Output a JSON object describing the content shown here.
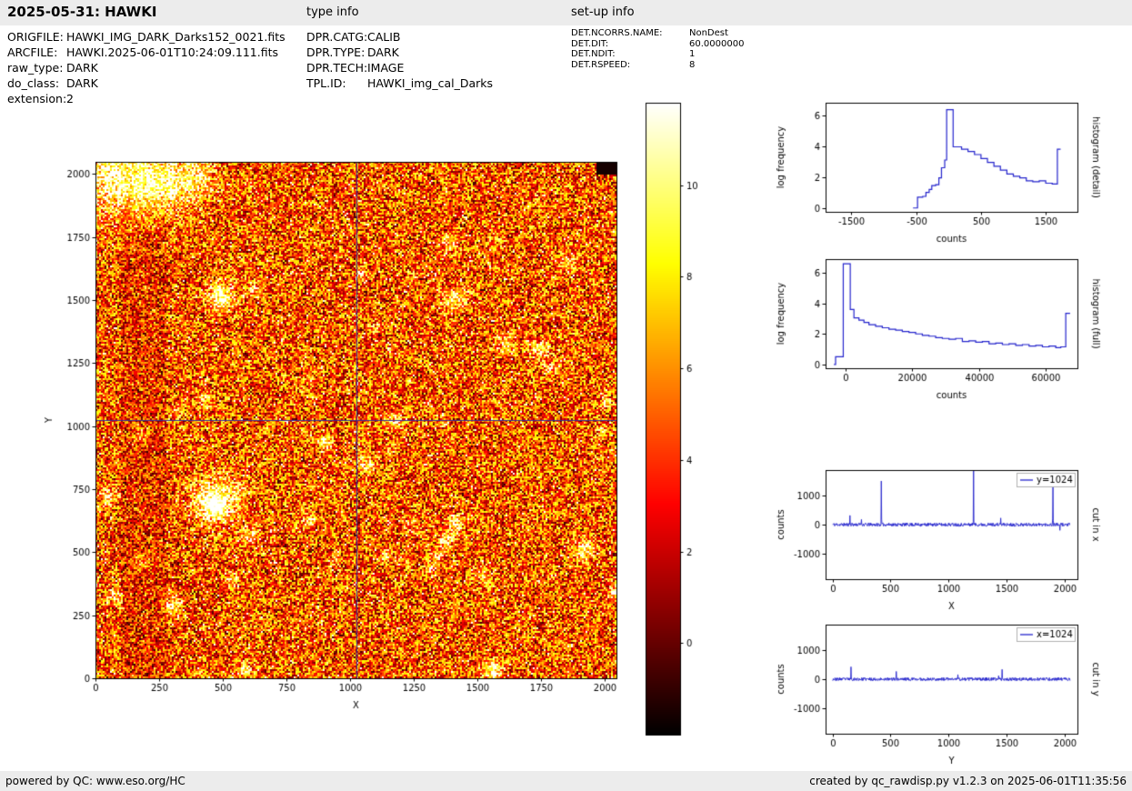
{
  "header": {
    "title": "2025-05-31: HAWKI",
    "type_info_label": "type info",
    "setup_info_label": "set-up info"
  },
  "file_info": {
    "rows": [
      {
        "label": "ORIGFILE:",
        "value": "HAWKI_IMG_DARK_Darks152_0021.fits"
      },
      {
        "label": "ARCFILE:",
        "value": "HAWKI.2025-06-01T10:24:09.111.fits"
      },
      {
        "label": "raw_type:",
        "value": "DARK"
      },
      {
        "label": "do_class:",
        "value": "DARK"
      },
      {
        "label": "extension:",
        "value": "2"
      }
    ]
  },
  "type_info": {
    "rows": [
      {
        "label": "DPR.CATG:",
        "value": "CALIB"
      },
      {
        "label": "DPR.TYPE:",
        "value": "DARK"
      },
      {
        "label": "DPR.TECH:",
        "value": "IMAGE"
      },
      {
        "label": "TPL.ID:",
        "value": "HAWKI_img_cal_Darks"
      }
    ]
  },
  "setup_info": {
    "rows": [
      {
        "label": "DET.NCORRS.NAME:",
        "value": "NonDest"
      },
      {
        "label": "DET.DIT:",
        "value": "60.0000000"
      },
      {
        "label": "DET.NDIT:",
        "value": "1"
      },
      {
        "label": "DET.RSPEED:",
        "value": "8"
      }
    ]
  },
  "footer": {
    "left": "powered by QC: www.eso.org/HC",
    "right": "created by qc_rawdisp.py v1.2.3 on 2025-06-01T11:35:56"
  },
  "colors": {
    "line": "#2424cc",
    "crosshair": "#333399",
    "frame": "#000000",
    "bar_background": "#ececec"
  },
  "chart_data": [
    {
      "id": "raw_image",
      "type": "heatmap",
      "description": "2048x2048 raw dark frame shown with hot colormap, crosshair at x=1024 y=1024",
      "xlabel": "X",
      "ylabel": "Y",
      "xlim": [
        0,
        2048
      ],
      "ylim": [
        0,
        2048
      ],
      "xticks": [
        0,
        250,
        500,
        750,
        1000,
        1250,
        1500,
        1750,
        2000
      ],
      "yticks": [
        0,
        250,
        500,
        750,
        1000,
        1250,
        1500,
        1750,
        2000
      ],
      "crosshair_x": 1024,
      "crosshair_y": 1024,
      "colormap": "hot",
      "colorbar": {
        "ticks": [
          0,
          2,
          4,
          6,
          8,
          10
        ],
        "vmin": -2,
        "vmax": 11.8
      }
    },
    {
      "id": "histogram_detail",
      "type": "line",
      "style": "step",
      "xlabel": "counts",
      "ylabel": "log frequency",
      "right_label": "histogram (detail)",
      "xlim": [
        -1900,
        1990
      ],
      "ylim": [
        -0.25,
        6.8
      ],
      "xticks": [
        -1500,
        -500,
        500,
        1500
      ],
      "yticks": [
        0,
        2,
        4,
        6
      ],
      "points": [
        [
          -550,
          0
        ],
        [
          -480,
          0.7
        ],
        [
          -400,
          0.75
        ],
        [
          -350,
          1.0
        ],
        [
          -300,
          1.2
        ],
        [
          -260,
          1.45
        ],
        [
          -200,
          1.5
        ],
        [
          -150,
          1.95
        ],
        [
          -110,
          2.6
        ],
        [
          -60,
          3.1
        ],
        [
          -30,
          6.35
        ],
        [
          70,
          3.95
        ],
        [
          200,
          3.8
        ],
        [
          300,
          3.65
        ],
        [
          400,
          3.45
        ],
        [
          500,
          3.2
        ],
        [
          600,
          2.95
        ],
        [
          700,
          2.7
        ],
        [
          800,
          2.45
        ],
        [
          900,
          2.2
        ],
        [
          1000,
          2.05
        ],
        [
          1100,
          1.95
        ],
        [
          1200,
          1.75
        ],
        [
          1300,
          1.7
        ],
        [
          1400,
          1.75
        ],
        [
          1500,
          1.6
        ],
        [
          1600,
          1.55
        ],
        [
          1660,
          1.55
        ],
        [
          1680,
          3.8
        ],
        [
          1730,
          3.8
        ]
      ]
    },
    {
      "id": "histogram_full",
      "type": "line",
      "style": "step",
      "xlabel": "counts",
      "ylabel": "log frequency",
      "right_label": "histogram (full)",
      "xlim": [
        -6000,
        69500
      ],
      "ylim": [
        -0.25,
        6.9
      ],
      "xticks": [
        0,
        20000,
        40000,
        60000
      ],
      "yticks": [
        0,
        2,
        4,
        6
      ],
      "points": [
        [
          -3500,
          0
        ],
        [
          -3000,
          0.5
        ],
        [
          -700,
          6.6
        ],
        [
          900,
          6.6
        ],
        [
          1400,
          3.6
        ],
        [
          2500,
          3.05
        ],
        [
          4000,
          2.9
        ],
        [
          5500,
          2.75
        ],
        [
          7000,
          2.6
        ],
        [
          9000,
          2.5
        ],
        [
          11000,
          2.4
        ],
        [
          13000,
          2.3
        ],
        [
          15000,
          2.25
        ],
        [
          17000,
          2.15
        ],
        [
          19000,
          2.1
        ],
        [
          21000,
          2.0
        ],
        [
          23000,
          1.9
        ],
        [
          25000,
          1.85
        ],
        [
          27000,
          1.75
        ],
        [
          29000,
          1.7
        ],
        [
          31000,
          1.65
        ],
        [
          33000,
          1.7
        ],
        [
          35000,
          1.5
        ],
        [
          37000,
          1.55
        ],
        [
          39000,
          1.45
        ],
        [
          41000,
          1.5
        ],
        [
          43000,
          1.35
        ],
        [
          45000,
          1.4
        ],
        [
          47000,
          1.3
        ],
        [
          49000,
          1.35
        ],
        [
          51000,
          1.25
        ],
        [
          53000,
          1.3
        ],
        [
          55000,
          1.2
        ],
        [
          57000,
          1.25
        ],
        [
          59000,
          1.15
        ],
        [
          61000,
          1.2
        ],
        [
          63000,
          1.1
        ],
        [
          64500,
          1.15
        ],
        [
          66000,
          3.35
        ],
        [
          67300,
          3.35
        ]
      ]
    },
    {
      "id": "cut_in_x",
      "type": "line",
      "legend": "y=1024",
      "xlabel": "X",
      "ylabel": "counts",
      "right_label": "cut in x",
      "xlim": [
        -60,
        2110
      ],
      "ylim": [
        -1900,
        1900
      ],
      "xticks": [
        0,
        500,
        1000,
        1500,
        2000
      ],
      "yticks": [
        -1000,
        0,
        1000
      ],
      "noise_amplitude": 60,
      "spikes": [
        [
          150,
          320
        ],
        [
          250,
          180
        ],
        [
          420,
          1520
        ],
        [
          1215,
          1990
        ],
        [
          1450,
          230
        ],
        [
          1900,
          1400
        ],
        [
          1960,
          -200
        ]
      ]
    },
    {
      "id": "cut_in_y",
      "type": "line",
      "legend": "x=1024",
      "xlabel": "Y",
      "ylabel": "counts",
      "right_label": "cut in y",
      "xlim": [
        -60,
        2110
      ],
      "ylim": [
        -1900,
        1900
      ],
      "xticks": [
        0,
        500,
        1000,
        1500,
        2000
      ],
      "yticks": [
        -1000,
        0,
        1000
      ],
      "noise_amplitude": 55,
      "spikes": [
        [
          160,
          430
        ],
        [
          550,
          270
        ],
        [
          1080,
          160
        ],
        [
          1430,
          120
        ],
        [
          1460,
          340
        ]
      ]
    }
  ]
}
